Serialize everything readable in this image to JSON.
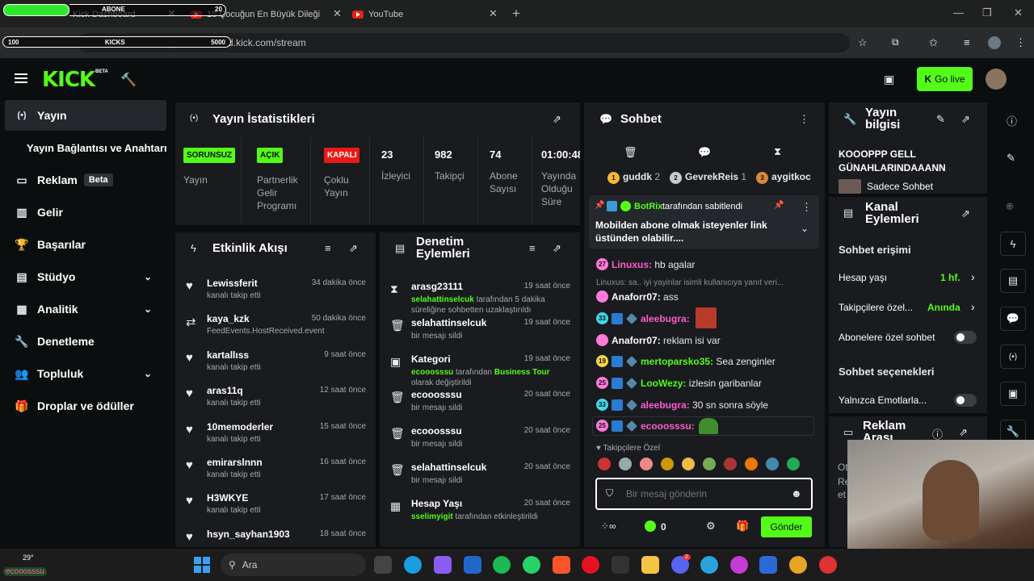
{
  "browser": {
    "tabs": [
      {
        "label": "Kick Dashboard"
      },
      {
        "label": "10 Çocuğun En Büyük Dileğini"
      },
      {
        "label": "YouTube"
      }
    ],
    "url": "https://dashboard.kick.com/stream",
    "overlay": {
      "abone_label": "ABONE",
      "abone_count": "20",
      "kicks_label": "KICKS",
      "left_value": "100",
      "right_value": "5000"
    }
  },
  "header": {
    "logo": "KICK",
    "logo_badge": "BETA",
    "go_live": "Go live"
  },
  "sidebar": {
    "items": [
      {
        "label": "Yayın"
      },
      {
        "label": "Yayın Bağlantısı ve Anahtarı"
      },
      {
        "label": "Reklam",
        "badge": "Beta"
      },
      {
        "label": "Gelir"
      },
      {
        "label": "Başarılar"
      },
      {
        "label": "Stüdyo"
      },
      {
        "label": "Analitik"
      },
      {
        "label": "Denetleme"
      },
      {
        "label": "Topluluk"
      },
      {
        "label": "Droplar ve ödüller"
      }
    ]
  },
  "stats": {
    "title": "Yayın İstatistikleri",
    "cols": [
      {
        "badge": "SORUNSUZ",
        "label": "Yayın"
      },
      {
        "badge": "AÇIK",
        "label": "Partnerlik Gelir Programı"
      },
      {
        "badge": "KAPALI",
        "label": "Çoklu Yayın"
      },
      {
        "value": "23",
        "label": "İzleyici"
      },
      {
        "value": "982",
        "label": "Takipçi"
      },
      {
        "value": "74",
        "label": "Abone Sayısı"
      },
      {
        "value": "01:00:48",
        "label": "Yayında Olduğu Süre"
      }
    ],
    "colors": {
      "sorunsuz": "#53fc18",
      "acik": "#53fc18",
      "kapali": "#e91916"
    }
  },
  "activity": {
    "title": "Etkinlik Akışı",
    "items": [
      {
        "name": "Lewissferit",
        "sub": "kanalı takip etti",
        "time": "34 dakika önce"
      },
      {
        "name": "kaya_kzk",
        "sub": "FeedEvents.HostReceived.event",
        "time": "50 dakika önce"
      },
      {
        "name": "kartallıss",
        "sub": "kanalı takip etti",
        "time": "9 saat önce"
      },
      {
        "name": "aras11q",
        "sub": "kanalı takip etti",
        "time": "12 saat önce"
      },
      {
        "name": "10memoderler",
        "sub": "kanalı takip etti",
        "time": "15 saat önce"
      },
      {
        "name": "emirarslnnn",
        "sub": "kanalı takip etti",
        "time": "16 saat önce"
      },
      {
        "name": "H3WKYE",
        "sub": "kanalı takip etti",
        "time": "17 saat önce"
      },
      {
        "name": "hsyn_sayhan1903",
        "sub": "",
        "time": "18 saat önce"
      }
    ]
  },
  "moderation": {
    "title": "Denetim Eylemleri",
    "items": [
      {
        "name": "arasg23111",
        "time": "19 saat önce",
        "g1": "selahattinselcuk",
        "t1": " tarafından 5 dakika süreliğine sohbetten uzaklaştırıldı",
        "g2": "",
        "t2": ""
      },
      {
        "name": "selahattinselcuk",
        "time": "19 saat önce",
        "g1": "",
        "t1": "bir mesajı sildi",
        "g2": "",
        "t2": ""
      },
      {
        "name": "Kategori",
        "time": "19 saat önce",
        "g1": "ecooosssu",
        "t1": " tarafından ",
        "g2": "Business Tour",
        "t2": " olarak değiştirildi"
      },
      {
        "name": "ecooosssu",
        "time": "20 saat önce",
        "g1": "",
        "t1": "bir mesajı sildi",
        "g2": "",
        "t2": ""
      },
      {
        "name": "ecooosssu",
        "time": "20 saat önce",
        "g1": "",
        "t1": "bir mesajı sildi",
        "g2": "",
        "t2": ""
      },
      {
        "name": "selahattinselcuk",
        "time": "20 saat önce",
        "g1": "",
        "t1": "bir mesajı sildi",
        "g2": "",
        "t2": ""
      },
      {
        "name": "Hesap Yaşı",
        "time": "20 saat önce",
        "g1": "sselimyigit",
        "t1": " tarafından etkinleştirildi",
        "g2": "",
        "t2": ""
      }
    ]
  },
  "chat": {
    "title": "Sohbet",
    "top_gifters": [
      {
        "rank": "1",
        "name": "guddk",
        "count": "2"
      },
      {
        "rank": "2",
        "name": "GevrekReis",
        "count": "1"
      },
      {
        "rank": "3",
        "name": "aygitkoc",
        "count": ""
      }
    ],
    "pinned": {
      "by": "BotRix",
      "by_suffix": "tarafından sabitlendi",
      "text": "Mobilden abone olmak isteyenler link üstünden olabilir...."
    },
    "reply_preview": "Linuxus: sa.. iyi yayinlar isimli kullanıcıya yanıt veri...",
    "messages": [
      {
        "level": "27",
        "user": "Linuxus",
        "text": "hb agalar",
        "ucolor": "#ff5ccb"
      },
      {
        "level": "",
        "user": "Anaforr07",
        "text": "ass",
        "ucolor": "#ffffff"
      },
      {
        "level": "33",
        "user": "aleebugra",
        "text": "",
        "ucolor": "#ff5ccb"
      },
      {
        "level": "",
        "user": "Anaforr07",
        "text": "reklam isi var",
        "ucolor": "#ffffff"
      },
      {
        "level": "19",
        "user": "mertoparsko35",
        "text": "Sea zenginler",
        "ucolor": "#53fc18"
      },
      {
        "level": "25",
        "user": "LooWezy",
        "text": "izlesin garibanlar",
        "ucolor": "#53fc18"
      },
      {
        "level": "33",
        "user": "aleebugra",
        "text": "30 sn sonra söyle",
        "ucolor": "#ff5ccb"
      },
      {
        "level": "25",
        "user": "ecooosssu",
        "text": "",
        "ucolor": "#ff5ccb"
      }
    ],
    "followers_only": "Takipçilere Özel",
    "input_placeholder": "Bir mesaj gönderin",
    "kicks_count": "0",
    "send": "Gönder"
  },
  "stream_info": {
    "title": "Yayın bilgisi",
    "stream_title": "KOOOPPP GELL GÜNAHLARINDAAANN",
    "mode": "Sadece Sohbet"
  },
  "channel_actions": {
    "title": "Kanal Eylemleri",
    "chat_access": "Sohbet erişimi",
    "account_age": "Hesap yaşı",
    "account_age_val": "1 hf.",
    "followers_only": "Takipçilere özel...",
    "followers_only_val": "Anında",
    "subs_only": "Abonelere özel sohbet",
    "chat_options": "Sohbet seçenekleri",
    "emotes_only": "Yalnızca Emotlarla..."
  },
  "ad_break": {
    "title": "Reklam Arası",
    "text_1": "Ot",
    "text_2": "Re",
    "text_3": "et"
  },
  "taskbar": {
    "weather_temp": "29°",
    "overlay_name": "ecooosssu",
    "search": "Ara",
    "discord_badge": "2"
  }
}
